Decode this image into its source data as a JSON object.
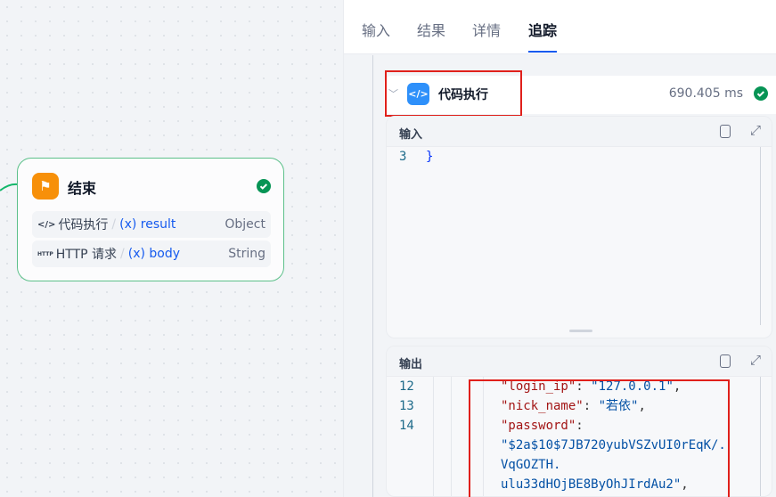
{
  "canvas": {
    "end_node": {
      "title": "结束",
      "icon": "end-flag-icon",
      "status": "success",
      "vars": [
        {
          "tag": "</>",
          "source": "代码执行",
          "name": "(x) result",
          "type": "Object"
        },
        {
          "tag": "HTTP",
          "source": "HTTP 请求",
          "name": "(x) body",
          "type": "String"
        }
      ]
    }
  },
  "panel": {
    "tabs": [
      {
        "label": "输入"
      },
      {
        "label": "结果"
      },
      {
        "label": "详情"
      },
      {
        "label": "追踪",
        "active": true
      }
    ],
    "trace_node": {
      "name": "代码执行",
      "icon": "code-icon",
      "duration": "690.405 ms",
      "status": "success"
    },
    "input_card": {
      "label": "输入",
      "lines": [
        {
          "no": "3",
          "text": "}"
        }
      ]
    },
    "output_card": {
      "label": "输出",
      "line_numbers": [
        "12",
        "13",
        "14"
      ],
      "lines": [
        {
          "key": "\"login_ip\"",
          "colon": ": ",
          "value": "\"127.0.0.1\"",
          "end": ","
        },
        {
          "key": "\"nick_name\"",
          "colon": ": ",
          "value": "\"若依\"",
          "end": ","
        },
        {
          "key": "\"password\"",
          "colon": ":",
          "value": "",
          "end": ""
        },
        {
          "key": "",
          "colon": "",
          "value": "\"$2a$10$7JB720yubVSZvUI0rEqK/.",
          "end": ""
        },
        {
          "key": "",
          "colon": "",
          "value": "VqGOZTH.",
          "end": ""
        },
        {
          "key": "",
          "colon": "",
          "value": "ulu33dHOjBE8ByOhJIrdAu2\"",
          "end": ","
        }
      ]
    }
  },
  "colors": {
    "accent": "#155aef",
    "success": "#12b76a",
    "highlight": "#e0201b",
    "end_icon": "#f79009",
    "code_icon": "#2e90fa"
  }
}
